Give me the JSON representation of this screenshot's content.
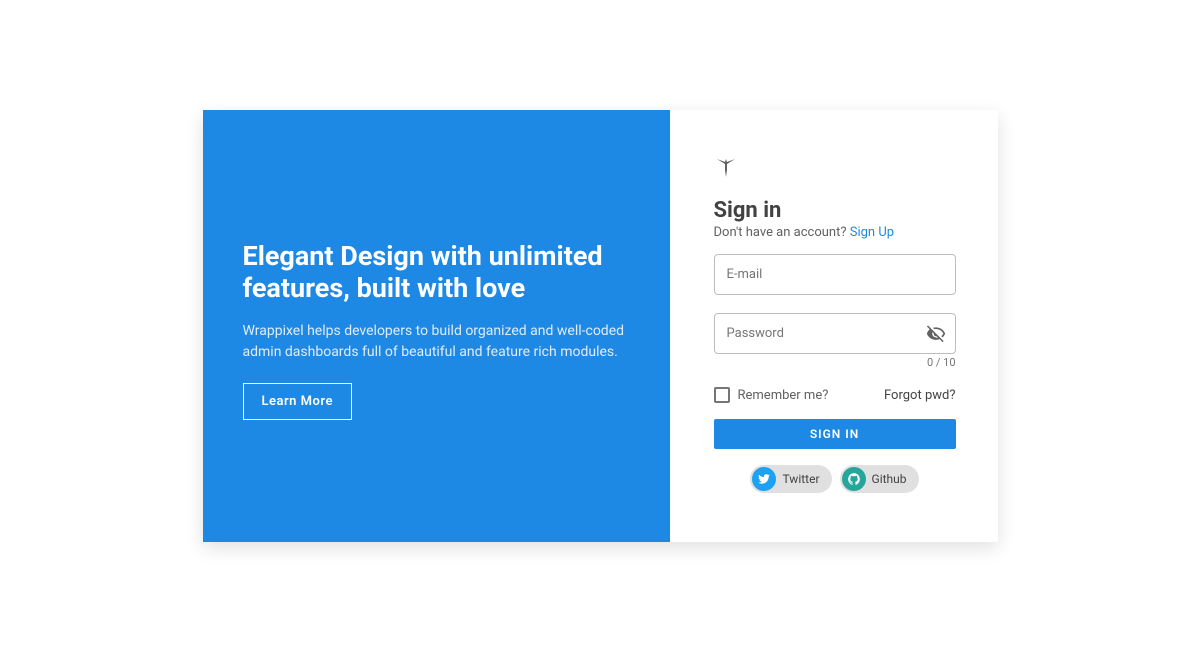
{
  "promo": {
    "title": "Elegant Design with unlimited features, built with love",
    "text": "Wrappixel helps developers to build organized and well-coded admin dashboards full of beautiful and feature rich modules.",
    "button": "Learn More"
  },
  "signin": {
    "title": "Sign in",
    "no_account_text": "Don't have an account? ",
    "signup_link": "Sign Up",
    "email_placeholder": "E-mail",
    "password_placeholder": "Password",
    "char_counter": "0 / 10",
    "remember_label": "Remember me?",
    "forgot_label": "Forgot pwd?",
    "submit_label": "SIGN IN"
  },
  "social": {
    "twitter": "Twitter",
    "github": "Github"
  }
}
